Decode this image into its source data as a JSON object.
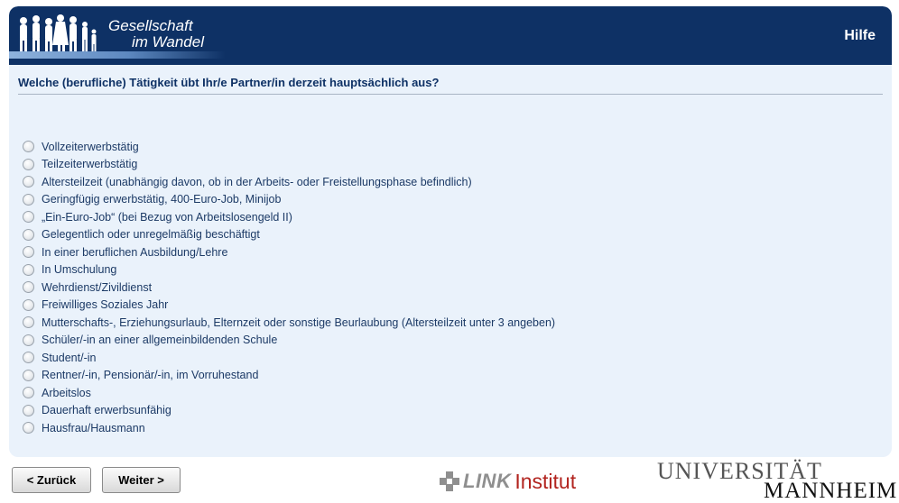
{
  "header": {
    "logo_line1": "Gesellschaft",
    "logo_line2": "im Wandel",
    "help_label": "Hilfe"
  },
  "question": "Welche (berufliche) Tätigkeit übt Ihr/e Partner/in derzeit hauptsächlich aus?",
  "options": [
    "Vollzeiterwerbstätig",
    "Teilzeiterwerbstätig",
    "Altersteilzeit (unabhängig davon, ob in der Arbeits- oder Freistellungsphase befindlich)",
    "Geringfügig erwerbstätig, 400-Euro-Job, Minijob",
    "„Ein-Euro-Job“ (bei Bezug von Arbeitslosengeld II)",
    "Gelegentlich oder unregelmäßig beschäftigt",
    "In einer beruflichen Ausbildung/Lehre",
    "In Umschulung",
    "Wehrdienst/Zivildienst",
    "Freiwilliges Soziales Jahr",
    "Mutterschafts-, Erziehungsurlaub, Elternzeit oder sonstige Beurlaubung (Altersteilzeit unter 3 angeben)",
    "Schüler/-in an einer allgemeinbildenden Schule",
    "Student/-in",
    "Rentner/-in, Pensionär/-in, im Vorruhestand",
    "Arbeitslos",
    "Dauerhaft erwerbsunfähig",
    "Hausfrau/Hausmann"
  ],
  "nav": {
    "back_label": "< Zurück",
    "next_label": "Weiter >"
  },
  "footer": {
    "link_word": "LINK",
    "link_institut": "Institut",
    "uni_line1": "UNIVERSITÄT",
    "uni_line2": "MANNHEIM"
  },
  "colors": {
    "header_bg": "#0e3165",
    "panel_bg": "#eaf2fb",
    "link_red": "#b2241f"
  }
}
